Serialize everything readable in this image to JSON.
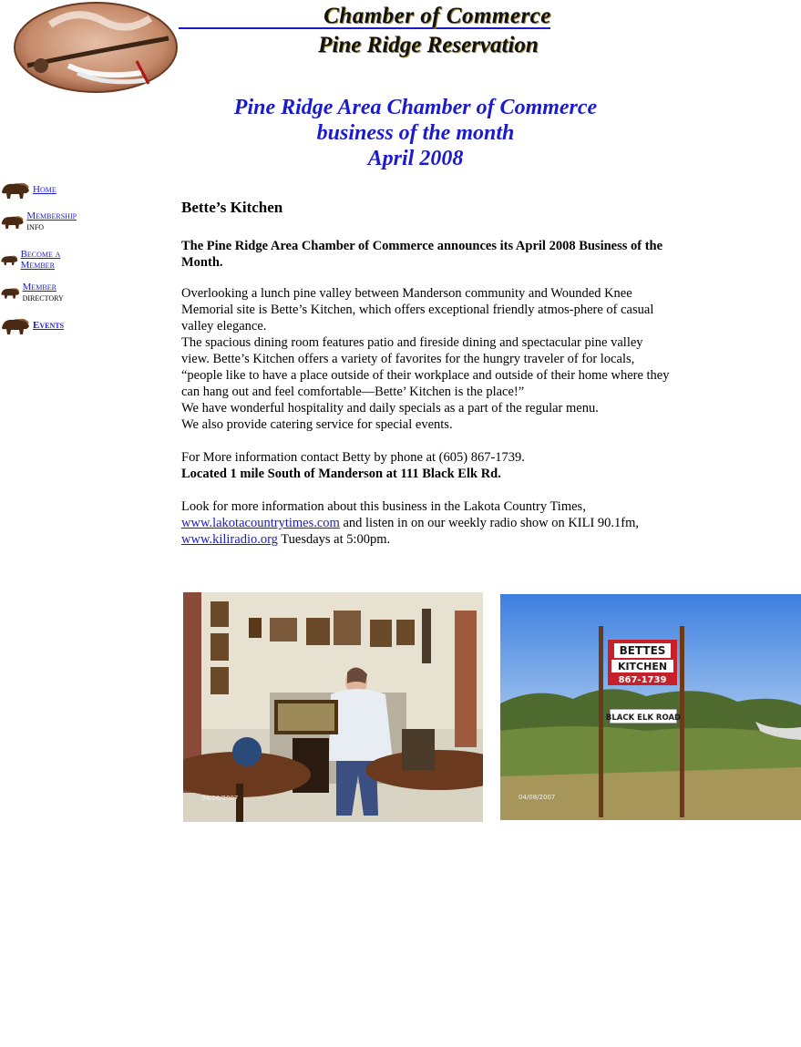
{
  "header": {
    "title_line1": "Chamber of Commerce",
    "title_line2": "Pine Ridge Reservation"
  },
  "banner": {
    "line1": "Pine Ridge Area Chamber of Commerce",
    "line2": "business of the month",
    "line3": "April 2008"
  },
  "nav": {
    "items": [
      {
        "link": "Home",
        "rest": ""
      },
      {
        "link": "Membership",
        "rest": " info"
      },
      {
        "link": "Become a Member",
        "rest": ""
      },
      {
        "link": "Member",
        "rest": " directory"
      },
      {
        "link": "Events",
        "rest": ""
      }
    ]
  },
  "article": {
    "business_name": "Bette’s Kitchen",
    "announcement": "The Pine Ridge Area Chamber of Commerce announces its April 2008 Business of the Month.",
    "p1": "Overlooking a lunch pine valley between Manderson community and Wounded Knee Memorial site is Bette’s Kitchen, which offers exceptional friendly atmos-phere of casual valley elegance.",
    "p2": "The spacious dining room features patio and fireside dining and spectacular pine valley view.  Bette’s Kitchen offers a variety of favorites for the hungry traveler of for locals, “people like to have a place outside of their workplace and outside of their home where they can hang out and feel comfortable—Bette’ Kitchen is the place!”",
    "p3": "We have wonderful hospitality and daily specials as a part of the regular menu.",
    "p4": "We also provide catering service for special events.",
    "contact": "For More information contact Betty by phone at (605) 867-1739.",
    "location": "Located 1 mile South of Manderson at 111 Black Elk Rd.",
    "more_prefix": "Look for more information about this business in the Lakota Country Times,",
    "link1": "www.lakotacountrytimes.com",
    "more_middle": " and listen in on our weekly radio show on KILI 90.1fm,",
    "link2": "www.kiliradio.org",
    "more_suffix": " Tuesdays at 5:00pm."
  },
  "photos": {
    "sign_line1": "BETTES",
    "sign_line2": "KITCHEN",
    "sign_phone": "867-1739",
    "road_sign": "BLACK ELK ROAD",
    "date_stamp1": "04/08/2007",
    "date_stamp2": "04/08/2007"
  },
  "colors": {
    "link": "#1a1ad0",
    "banner": "#1a1ad0"
  }
}
